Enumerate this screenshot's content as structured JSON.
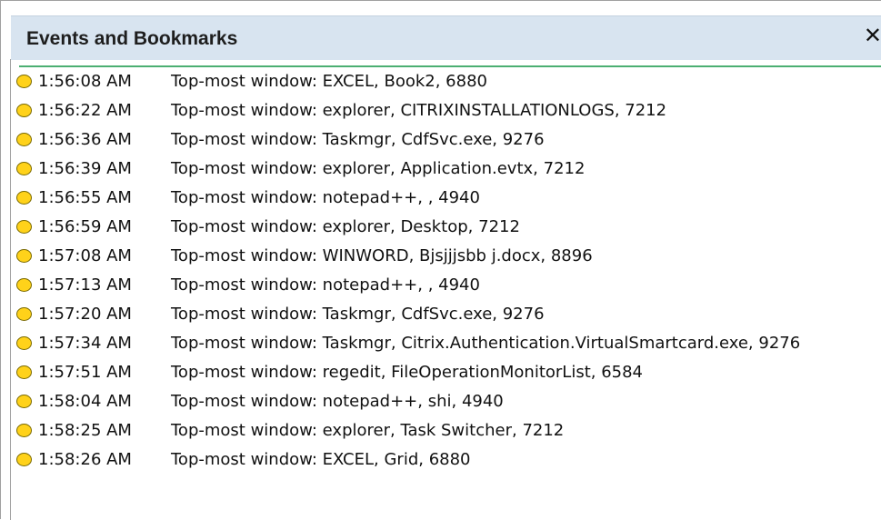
{
  "panel": {
    "title": "Events and Bookmarks",
    "close_label": "✕"
  },
  "events": [
    {
      "time": "1:56:08 AM",
      "text": "Top-most window: EXCEL, Book2, 6880"
    },
    {
      "time": "1:56:22 AM",
      "text": "Top-most window:  explorer, CITRIXINSTALLATIONLOGS, 7212"
    },
    {
      "time": "1:56:36 AM",
      "text": "Top-most window: Taskmgr, CdfSvc.exe, 9276"
    },
    {
      "time": "1:56:39 AM",
      "text": "Top-most window: explorer, Application.evtx, 7212"
    },
    {
      "time": "1:56:55 AM",
      "text": "Top-most window: notepad++, , 4940"
    },
    {
      "time": "1:56:59 AM",
      "text": "Top-most window: explorer, Desktop, 7212"
    },
    {
      "time": "1:57:08 AM",
      "text": "Top-most window: WINWORD, Bjsjjjsbb j.docx, 8896"
    },
    {
      "time": "1:57:13 AM",
      "text": "Top-most window: notepad++, , 4940"
    },
    {
      "time": "1:57:20 AM",
      "text": "Top-most window: Taskmgr, CdfSvc.exe, 9276"
    },
    {
      "time": "1:57:34  AM",
      "text": "Top-most  window:  Taskmgr,  Citrix.Authentication.VirtualSmartcard.exe,  9276"
    },
    {
      "time": "1:57:51  AM",
      "text": "Top-most window: regedit, FileOperationMonitorList, 6584"
    },
    {
      "time": "1:58:04 AM",
      "text": "Top-most window: notepad++, shi, 4940"
    },
    {
      "time": "1:58:25 AM",
      "text": "Top-most window: explorer, Task Switcher, 7212"
    },
    {
      "time": "1:58:26 AM",
      "text": "Top-most window: EXCEL, Grid, 6880"
    }
  ]
}
